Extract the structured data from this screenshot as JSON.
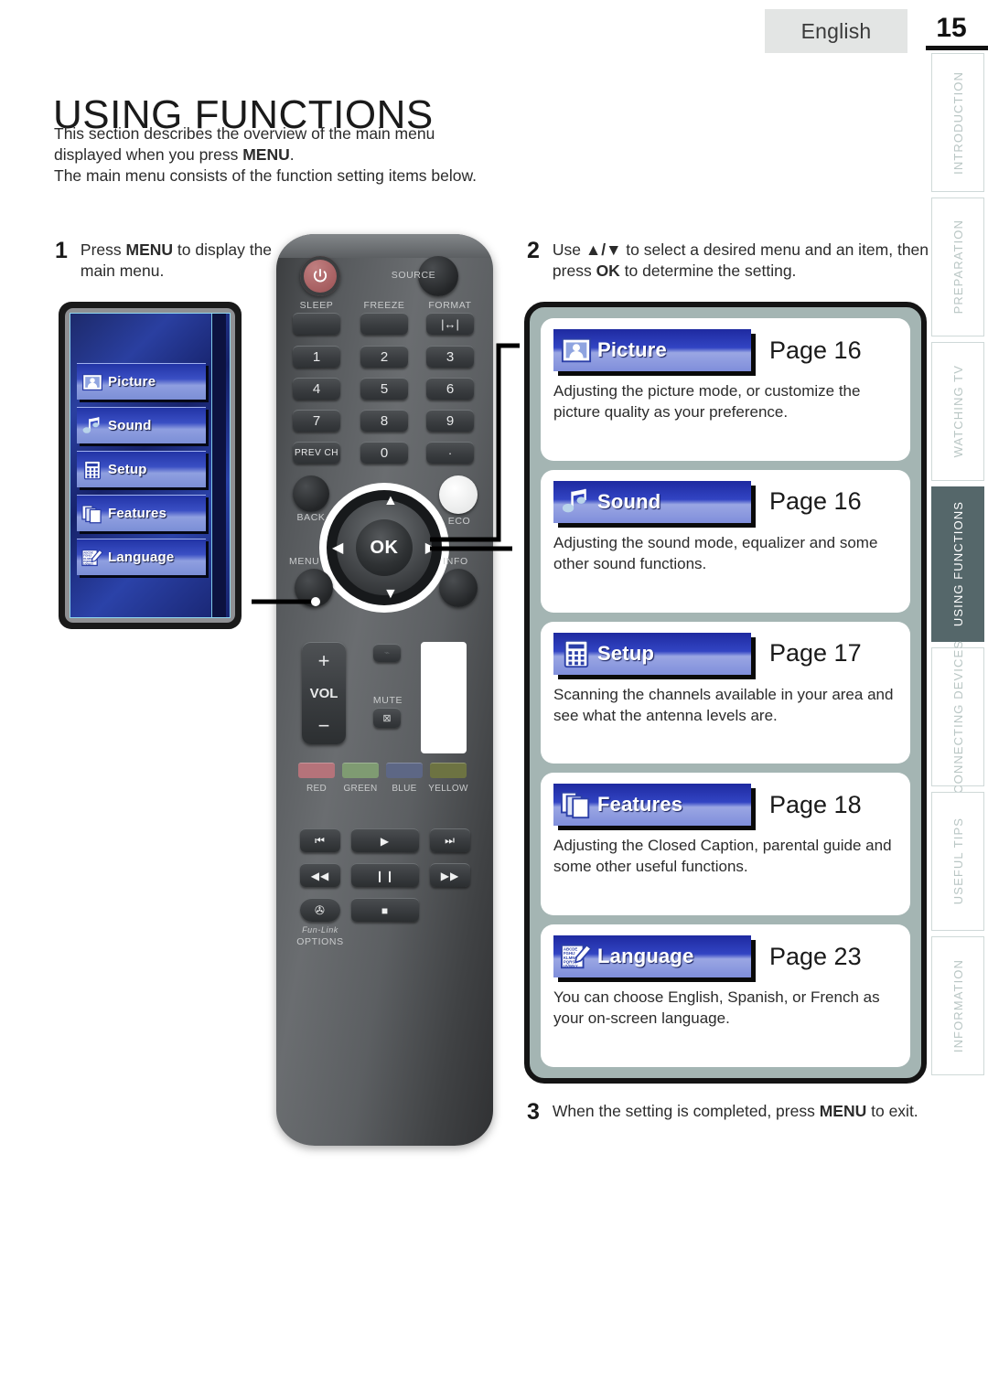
{
  "header": {
    "language_chip": "English",
    "page_number": "15"
  },
  "side_tabs": [
    {
      "label": "INTRODUCTION",
      "active": false
    },
    {
      "label": "PREPARATION",
      "active": false
    },
    {
      "label": "WATCHING TV",
      "active": false
    },
    {
      "label": "USING FUNCTIONS",
      "active": true
    },
    {
      "label": "CONNECTING DEVICES",
      "active": false
    },
    {
      "label": "USEFUL TIPS",
      "active": false
    },
    {
      "label": "INFORMATION",
      "active": false
    }
  ],
  "title": "USING FUNCTIONS",
  "intro": {
    "line1": "This section describes the overview of the main menu",
    "line2_pre": "displayed when you press ",
    "line2_bold": "MENU",
    "line2_post": ".",
    "line3": "The main menu consists of the function setting items below."
  },
  "steps": {
    "one": {
      "num": "1",
      "pre": "Press ",
      "bold": "MENU",
      "post": " to display the main menu."
    },
    "two": {
      "num": "2",
      "pre": "Use ",
      "arrows": "▲/▼",
      "mid": " to select a desired menu and an item, then press ",
      "bold": "OK",
      "post": " to determine the setting."
    },
    "three": {
      "num": "3",
      "pre": "When the setting is completed, press ",
      "bold": "MENU",
      "post": " to exit."
    }
  },
  "tv_menu": {
    "items": [
      {
        "label": "Picture",
        "icon": "picture-icon"
      },
      {
        "label": "Sound",
        "icon": "sound-icon"
      },
      {
        "label": "Setup",
        "icon": "setup-icon"
      },
      {
        "label": "Features",
        "icon": "features-icon"
      },
      {
        "label": "Language",
        "icon": "language-icon"
      }
    ]
  },
  "menu_cards": [
    {
      "label": "Picture",
      "icon": "picture-icon",
      "page": "Page 16",
      "desc": "Adjusting the picture mode, or customize the picture quality as your preference."
    },
    {
      "label": "Sound",
      "icon": "sound-icon",
      "page": "Page 16",
      "desc": "Adjusting the sound mode, equalizer and some other sound functions."
    },
    {
      "label": "Setup",
      "icon": "setup-icon",
      "page": "Page 17",
      "desc": "Scanning the channels available in your area and see what the antenna levels are."
    },
    {
      "label": "Features",
      "icon": "features-icon",
      "page": "Page 18",
      "desc": "Adjusting the Closed Caption, parental guide and some other useful functions."
    },
    {
      "label": "Language",
      "icon": "language-icon",
      "page": "Page 23",
      "desc": "You can choose English, Spanish, or French as your on-screen language."
    }
  ],
  "remote": {
    "power_icon": "power-icon",
    "source_label": "SOURCE",
    "sleep_label": "SLEEP",
    "freeze_label": "FREEZE",
    "format_label": "FORMAT",
    "format_glyph": "|↔|",
    "keys": [
      "1",
      "2",
      "3",
      "4",
      "5",
      "6",
      "7",
      "8",
      "9"
    ],
    "prev_ch": "PREV CH",
    "zero": "0",
    "dot": "·",
    "back_label": "BACK",
    "eco_label": "ECO",
    "menu_label": "MENU",
    "info_label": "INFO",
    "ok_label": "OK",
    "arrow_up": "▲",
    "arrow_down": "▼",
    "arrow_left": "◀",
    "arrow_right": "▶",
    "vol_label": "VOL",
    "vol_plus": "+",
    "vol_minus": "−",
    "mute_label": "MUTE",
    "color_keys": [
      {
        "name": "RED",
        "color": "#b5737a"
      },
      {
        "name": "GREEN",
        "color": "#7f9b72"
      },
      {
        "name": "BLUE",
        "color": "#5d6785"
      },
      {
        "name": "YELLOW",
        "color": "#6d7342"
      }
    ],
    "transport": [
      "⏮",
      "▶",
      "⏭",
      "◀◀",
      "❙❙",
      "▶▶"
    ],
    "stop_glyph": "■",
    "options_brand": "Fun-Link",
    "options_label": "OPTIONS"
  },
  "colors": {
    "panel_bg": "#a4b5b3",
    "tab_active": "#55676a",
    "tab_text": "#b9c6c4",
    "banner_blue": "#2433ad",
    "chip_bg": "#e3e5e4"
  }
}
